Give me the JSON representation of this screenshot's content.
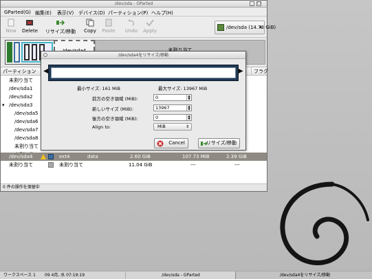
{
  "main_window": {
    "title": "/dev/sda - GParted",
    "menu": [
      "GParted(G)",
      "編集(E)",
      "表示(V)",
      "デバイス(D)",
      "パーティション(P)",
      "ヘルプ(H)"
    ],
    "toolbar": {
      "new": "New",
      "delete": "Delete",
      "resize_move": "リサイズ/移動",
      "copy": "Copy",
      "paste": "Paste",
      "undo": "Undo",
      "apply": "Apply"
    },
    "device_selector": "/dev/sda (14.73 GiB)",
    "graph": {
      "selected_partition": "/dev/sda4",
      "unallocated": "未割り当て"
    },
    "columns": {
      "partition": "パーティション",
      "flags": "フラグ"
    },
    "rows": [
      {
        "name": "未割り当て"
      },
      {
        "name": "/dev/sda1"
      },
      {
        "name": "/dev/sda2"
      },
      {
        "name": "/dev/sda3"
      },
      {
        "name": "/dev/sda5"
      },
      {
        "name": "/dev/sda6"
      },
      {
        "name": "/dev/sda7"
      },
      {
        "name": "/dev/sda8"
      },
      {
        "name": "未割り当て"
      },
      {
        "name": "/dev/sda4",
        "fs": "ext4",
        "label": "data",
        "size": "2.60 GiB",
        "used": "107.73 MiB",
        "unused": "2.39 GiB"
      },
      {
        "name": "未割り当て",
        "fs": "未割り当て",
        "size": "11.04 GiB",
        "used": "---",
        "unused": "---"
      }
    ],
    "right_fragments": {
      "b1": "B",
      "b2": "B",
      "b3": "B",
      "dash1": "--",
      "b5": "B",
      "b6": "B",
      "b7": "B",
      "b8": "B",
      "dash2": "--"
    },
    "status": "0 件の操作を保留中"
  },
  "dialog": {
    "title": "/dev/sda4をリサイズ/移動",
    "min_size": "最小サイズ:  161  MiB",
    "max_size": "最大サイズ:  13967  MiB",
    "fields": {
      "free_before_label": "前方の空き領域  (MiB):",
      "free_before_value": "0",
      "new_size_label": "新しいサイズ  (MiB):",
      "new_size_value": "13967",
      "free_after_label": "後方の空き領域  (MiB):",
      "free_after_value": "0",
      "align_label": "Align to:",
      "align_value": "MiB"
    },
    "buttons": {
      "cancel": "Cancel",
      "resize": "リサイズ/移動"
    }
  },
  "taskbar": {
    "workspace": "ワークスペース 1",
    "datetime": "09 4月, 水 07:19:19",
    "task_main": "/dev/sda - GParted",
    "task_dialog": "/dev/sda4をリサイズ/移動"
  },
  "colors": {
    "ext4": "#3a6ea5",
    "unallocated": "#a9a9a9",
    "selected_row": "#8f8a83",
    "dialog_bar": "#1f3a55"
  }
}
